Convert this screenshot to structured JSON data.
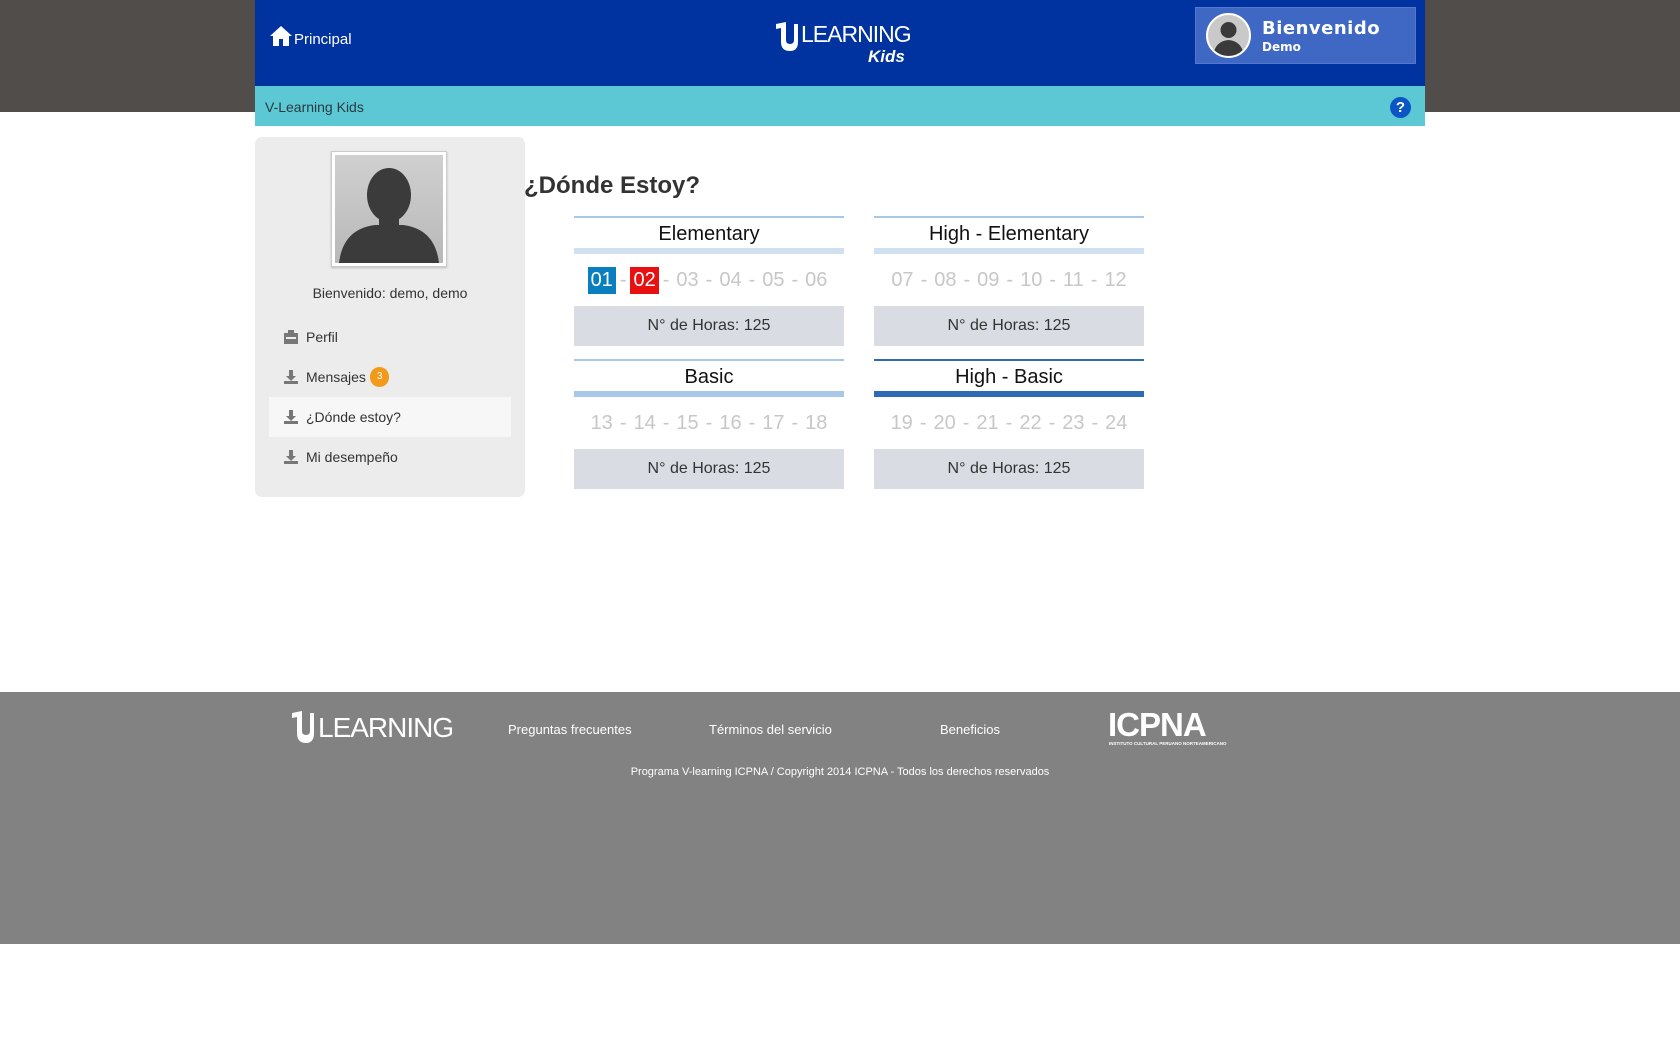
{
  "header": {
    "home_label": "Principal",
    "logo_text": "LEARNING",
    "logo_sub": "Kids",
    "user_greeting": "Bienvenido",
    "user_name": "Demo"
  },
  "subbar": {
    "title": "V-Learning Kids",
    "help_symbol": "?"
  },
  "sidebar": {
    "welcome": "Bienvenido: demo, demo",
    "items": [
      {
        "label": "Perfil",
        "icon": "profile-icon"
      },
      {
        "label": "Mensajes",
        "icon": "download-icon",
        "badge": "3"
      },
      {
        "label": "¿Dónde estoy?",
        "icon": "download-icon",
        "active": true
      },
      {
        "label": "Mi desempeño",
        "icon": "download-icon"
      }
    ]
  },
  "main": {
    "title": "¿Dónde Estoy?",
    "levels": [
      {
        "name": "Elementary",
        "cycles": [
          "01",
          "02",
          "03",
          "04",
          "05",
          "06"
        ],
        "hours": "N° de Horas: 125"
      },
      {
        "name": "High - Elementary",
        "cycles": [
          "07",
          "08",
          "09",
          "10",
          "11",
          "12"
        ],
        "hours": "N° de Horas: 125"
      },
      {
        "name": "Basic",
        "cycles": [
          "13",
          "14",
          "15",
          "16",
          "17",
          "18"
        ],
        "hours": "N° de Horas: 125"
      },
      {
        "name": "High - Basic",
        "cycles": [
          "19",
          "20",
          "21",
          "22",
          "23",
          "24"
        ],
        "hours": "N° de Horas: 125"
      }
    ],
    "colors": {
      "completed": "#0a7fbf",
      "current": "#e81010",
      "pending": "#c7c7c7"
    }
  },
  "footer": {
    "logo_text": "LEARNING",
    "links": [
      "Preguntas frecuentes",
      "Términos del servicio",
      "Beneficios"
    ],
    "partner_logo": "ICPNA",
    "partner_sub": "INSTITUTO CULTURAL PERUANO NORTEAMERICANO",
    "copyright": "Programa V-learning ICPNA / Copyright 2014 ICPNA - Todos los derechos reservados"
  }
}
